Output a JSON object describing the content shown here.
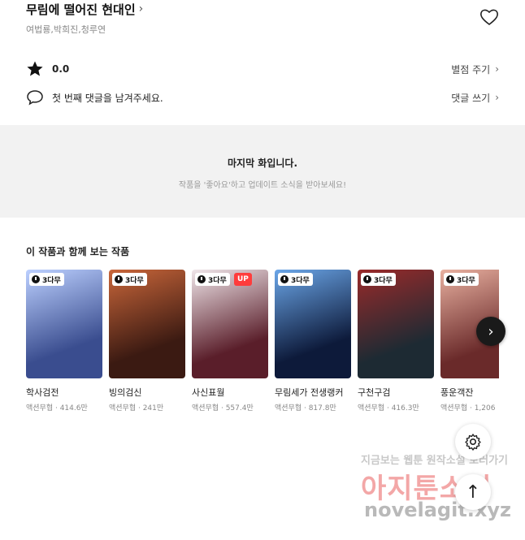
{
  "header": {
    "title": "무림에 떨어진 현대인",
    "title_chevron": "›",
    "authors": "여법룡,박희진,청루연"
  },
  "rating": {
    "value": "0.0",
    "action_label": "별점 주기"
  },
  "comment": {
    "prompt": "첫 번째 댓글을 남겨주세요.",
    "action_label": "댓글 쓰기"
  },
  "end_notice": {
    "title": "마지막 화입니다.",
    "subtitle": "작품을 '좋아요'하고 업데이트 소식을 받아보세요!"
  },
  "recommend": {
    "title": "이 작품과 함께 보는 작품",
    "badge_label": "3다무",
    "up_label": "UP",
    "items": [
      {
        "name": "학사검전",
        "meta": "액션무협 · 414.6만",
        "color_a": "#3a4d8f",
        "color_b": "#bcd0ff",
        "has_up": false
      },
      {
        "name": "빙의검신",
        "meta": "액션무협 · 241만",
        "color_a": "#3b1a12",
        "color_b": "#c9663a",
        "has_up": false
      },
      {
        "name": "사신표월",
        "meta": "액션무협 · 557.4만",
        "color_a": "#5a1e2a",
        "color_b": "#f0e6ea",
        "has_up": true
      },
      {
        "name": "무림세가 전생랭커",
        "meta": "액션무협 · 817.8만",
        "color_a": "#0d1a3a",
        "color_b": "#6ba6e8",
        "has_up": false
      },
      {
        "name": "구천구검",
        "meta": "액션무협 · 416.3만",
        "color_a": "#1d2a33",
        "color_b": "#9a2a2a",
        "has_up": false
      },
      {
        "name": "풍운객잔",
        "meta": "액션무협 · 1,206",
        "color_a": "#6a2a2a",
        "color_b": "#e8b0a0",
        "has_up": false
      }
    ]
  },
  "controls": {
    "next_glyph": "›",
    "top_glyph": "↑"
  },
  "watermark": {
    "line1": "지금보는 웹툰 원작소설 보러가기",
    "line2": "아지툰소설",
    "line3": "novelagit.xyz"
  }
}
